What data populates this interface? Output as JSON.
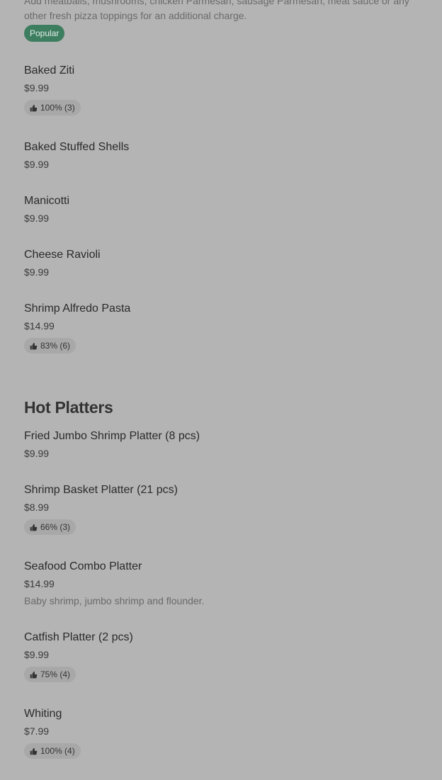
{
  "top_item": {
    "description": "Add meatballs, mushrooms, chicken Parmesan, sausage Parmesan, meat sauce or any other fresh pizza toppings for an additional charge.",
    "badge": "Popular"
  },
  "pasta_items": [
    {
      "name": "Baked Ziti",
      "price": "$9.99",
      "rating": "100% (3)"
    },
    {
      "name": "Baked Stuffed Shells",
      "price": "$9.99"
    },
    {
      "name": "Manicotti",
      "price": "$9.99"
    },
    {
      "name": "Cheese Ravioli",
      "price": "$9.99"
    },
    {
      "name": "Shrimp Alfredo Pasta",
      "price": "$14.99",
      "rating": "83% (6)"
    }
  ],
  "hot_platters": {
    "title": "Hot Platters",
    "items": [
      {
        "name": "Fried Jumbo Shrimp Platter (8 pcs)",
        "price": "$9.99"
      },
      {
        "name": "Shrimp Basket Platter (21 pcs)",
        "price": "$8.99",
        "rating": "66% (3)"
      },
      {
        "name": "Seafood Combo Platter",
        "price": "$14.99",
        "description": "Baby shrimp, jumbo shrimp and flounder."
      },
      {
        "name": "Catfish Platter (2 pcs)",
        "price": "$9.99",
        "rating": "75% (4)"
      },
      {
        "name": "Whiting",
        "price": "$7.99",
        "rating": "100% (4)"
      }
    ]
  }
}
